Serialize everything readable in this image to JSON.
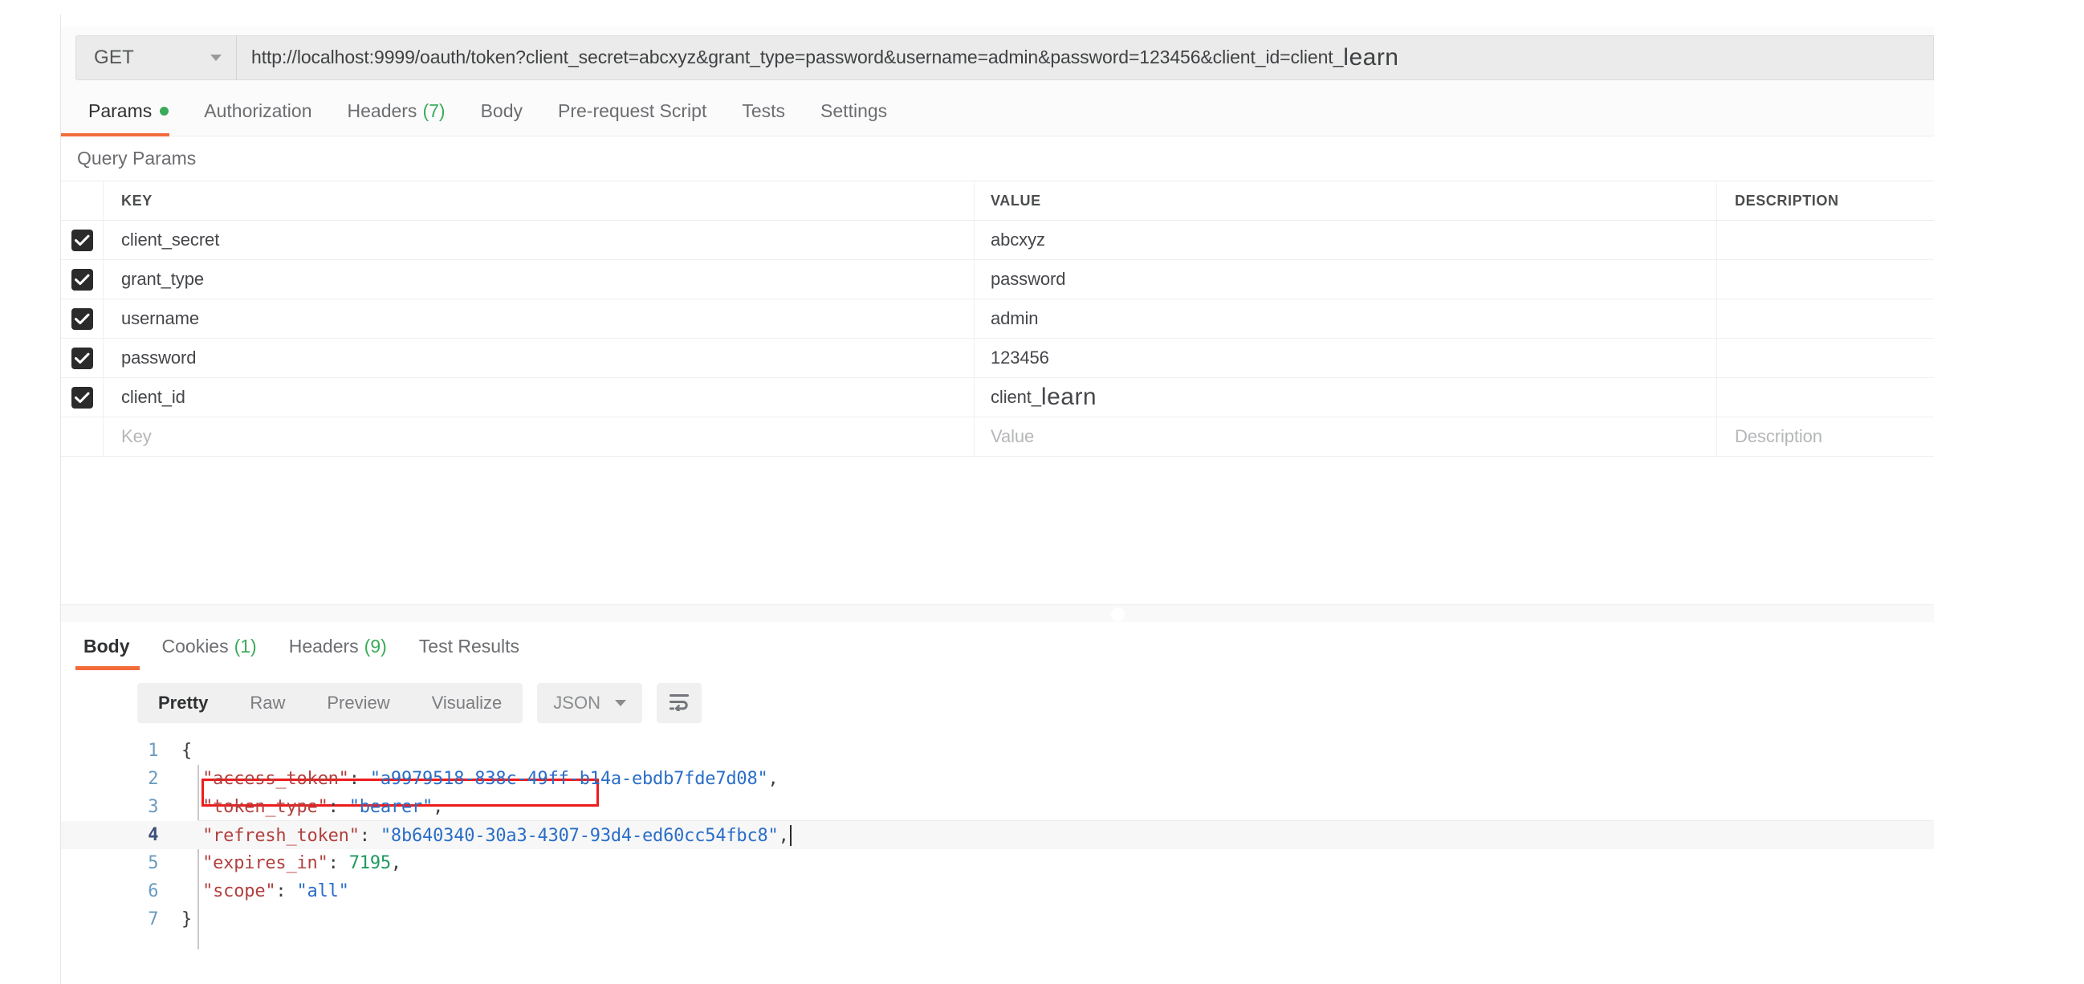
{
  "request": {
    "method": "GET",
    "url_main": "http://localhost:9999/oauth/token?client_secret=abcxyz&grant_type=password&username=admin&password=123456&client_id=client_",
    "url_suffix": "learn",
    "tabs": [
      {
        "label": "Params",
        "badge": "",
        "dot": true,
        "active": true
      },
      {
        "label": "Authorization",
        "badge": "",
        "dot": false,
        "active": false
      },
      {
        "label": "Headers",
        "badge": "(7)",
        "dot": false,
        "active": false
      },
      {
        "label": "Body",
        "badge": "",
        "dot": false,
        "active": false
      },
      {
        "label": "Pre-request Script",
        "badge": "",
        "dot": false,
        "active": false
      },
      {
        "label": "Tests",
        "badge": "",
        "dot": false,
        "active": false
      },
      {
        "label": "Settings",
        "badge": "",
        "dot": false,
        "active": false
      }
    ]
  },
  "params": {
    "section_label": "Query Params",
    "columns": {
      "key": "KEY",
      "value": "VALUE",
      "description": "DESCRIPTION"
    },
    "rows": [
      {
        "checked": true,
        "key": "client_secret",
        "value": "abcxyz",
        "value_suffix": "",
        "description": ""
      },
      {
        "checked": true,
        "key": "grant_type",
        "value": "password",
        "value_suffix": "",
        "description": ""
      },
      {
        "checked": true,
        "key": "username",
        "value": "admin",
        "value_suffix": "",
        "description": ""
      },
      {
        "checked": true,
        "key": "password",
        "value": "123456",
        "value_suffix": "",
        "description": ""
      },
      {
        "checked": true,
        "key": "client_id",
        "value": "client_",
        "value_suffix": "learn",
        "description": ""
      }
    ],
    "empty_row": {
      "key": "Key",
      "value": "Value",
      "description": "Description"
    }
  },
  "response": {
    "tabs": [
      {
        "label": "Body",
        "badge": "",
        "active": true
      },
      {
        "label": "Cookies",
        "badge": "(1)",
        "active": false
      },
      {
        "label": "Headers",
        "badge": "(9)",
        "active": false
      },
      {
        "label": "Test Results",
        "badge": "",
        "active": false
      }
    ],
    "format": {
      "buttons": [
        {
          "label": "Pretty",
          "active": true
        },
        {
          "label": "Raw",
          "active": false
        },
        {
          "label": "Preview",
          "active": false
        },
        {
          "label": "Visualize",
          "active": false
        }
      ],
      "selected_language": "JSON",
      "wrap_icon": "word-wrap-icon"
    },
    "body_lines": [
      {
        "no": "1",
        "segments": [
          {
            "t": "{",
            "c": "p"
          }
        ]
      },
      {
        "no": "2",
        "segments": [
          {
            "t": "  \"access_token\"",
            "c": "k"
          },
          {
            "t": ": ",
            "c": "p"
          },
          {
            "t": "\"a9979518-838c-49ff-b14a-ebdb7fde7d08\"",
            "c": "s"
          },
          {
            "t": ",",
            "c": "p"
          }
        ]
      },
      {
        "no": "3",
        "segments": [
          {
            "t": "  \"token_type\"",
            "c": "k"
          },
          {
            "t": ": ",
            "c": "p"
          },
          {
            "t": "\"bearer\"",
            "c": "s"
          },
          {
            "t": ",",
            "c": "p"
          }
        ]
      },
      {
        "no": "4",
        "active": true,
        "cursor": true,
        "segments": [
          {
            "t": "  \"refresh_token\"",
            "c": "k"
          },
          {
            "t": ": ",
            "c": "p"
          },
          {
            "t": "\"8b640340-30a3-4307-93d4-ed60cc54fbc8\"",
            "c": "s"
          },
          {
            "t": ",",
            "c": "p"
          }
        ]
      },
      {
        "no": "5",
        "segments": [
          {
            "t": "  \"expires_in\"",
            "c": "k"
          },
          {
            "t": ": ",
            "c": "p"
          },
          {
            "t": "7195",
            "c": "n"
          },
          {
            "t": ",",
            "c": "p"
          }
        ]
      },
      {
        "no": "6",
        "segments": [
          {
            "t": "  \"scope\"",
            "c": "k"
          },
          {
            "t": ": ",
            "c": "p"
          },
          {
            "t": "\"all\"",
            "c": "s"
          }
        ]
      },
      {
        "no": "7",
        "segments": [
          {
            "t": "}",
            "c": "p"
          }
        ]
      }
    ],
    "annotation": {
      "type": "red-highlight-box",
      "target_line": "2"
    },
    "parsed_json": {
      "access_token": "a9979518-838c-49ff-b14a-ebdb7fde7d08",
      "token_type": "bearer",
      "refresh_token": "8b640340-30a3-4307-93d4-ed60cc54fbc8",
      "expires_in": 7195,
      "scope": "all"
    }
  },
  "colors": {
    "accent": "#f26b3a",
    "success": "#3bab5a",
    "annotation": "#ee1c1c",
    "json_key": "#b1403e",
    "json_string": "#2a6ec7",
    "json_number": "#1f9a5f"
  }
}
